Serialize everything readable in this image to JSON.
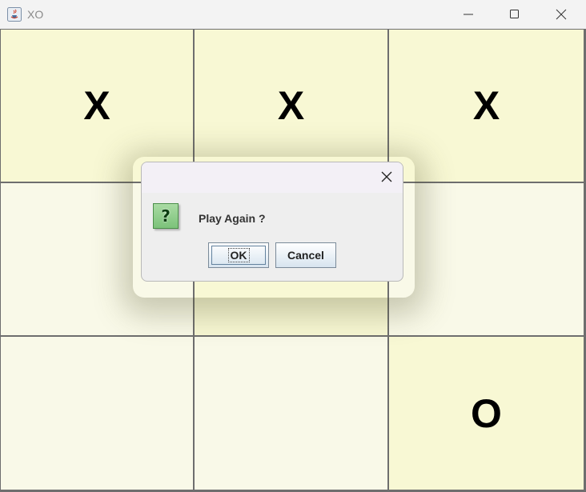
{
  "window": {
    "title": "XO",
    "icon": "java-icon",
    "controls": [
      "minimize-icon",
      "maximize-icon",
      "close-icon"
    ]
  },
  "board": {
    "cells": [
      "X",
      "X",
      "X",
      "",
      "",
      "",
      "",
      "",
      "O"
    ]
  },
  "dialog": {
    "icon": "question-icon",
    "icon_glyph": "?",
    "message": "Play Again ?",
    "ok_label": "OK",
    "cancel_label": "Cancel",
    "close_icon": "close-icon"
  },
  "colors": {
    "cell_highlight": "#f8f8d4",
    "cell_normal": "#f9f9e8",
    "grid_line": "#6e6e6e",
    "dialog_background": "#eeeeee"
  }
}
